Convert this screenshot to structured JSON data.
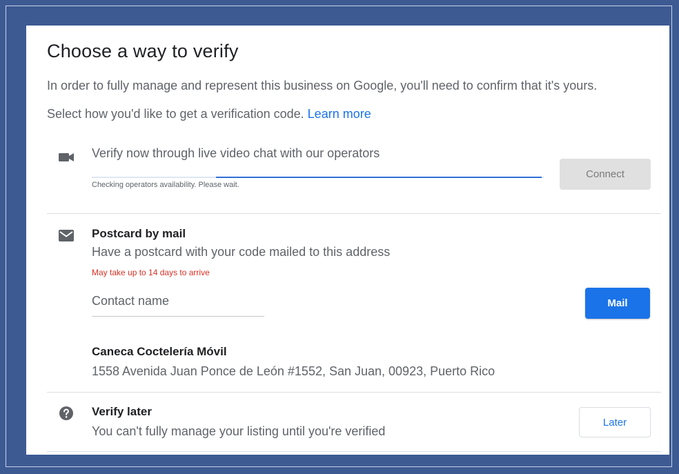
{
  "page": {
    "title": "Choose a way to verify",
    "intro": "In order to fully manage and represent this business on Google, you'll need to confirm that it's yours.",
    "select_prompt": "Select how you'd like to get a verification code.",
    "learn_more": "Learn more"
  },
  "video": {
    "icon": "video-camera-icon",
    "label": "Verify now through live video chat with our operators",
    "status": "Checking operators availability. Please wait.",
    "progress": 0.72,
    "button": "Connect"
  },
  "postcard": {
    "icon": "mail-icon",
    "title": "Postcard by mail",
    "description": "Have a postcard with your code mailed to this address",
    "note": "May take up to 14 days to arrive",
    "contact_placeholder": "Contact name",
    "contact_value": "",
    "button": "Mail",
    "business_name": "Caneca Coctelería Móvil",
    "address": "1558 Avenida Juan Ponce de León #1552, San Juan, 00923, Puerto Rico"
  },
  "later": {
    "icon": "help-circle-icon",
    "title": "Verify later",
    "description": "You can't fully manage your listing until you're verified",
    "button": "Later"
  },
  "colors": {
    "background": "#3d5a93",
    "accent": "#1a73e8",
    "warning": "#d93025"
  }
}
